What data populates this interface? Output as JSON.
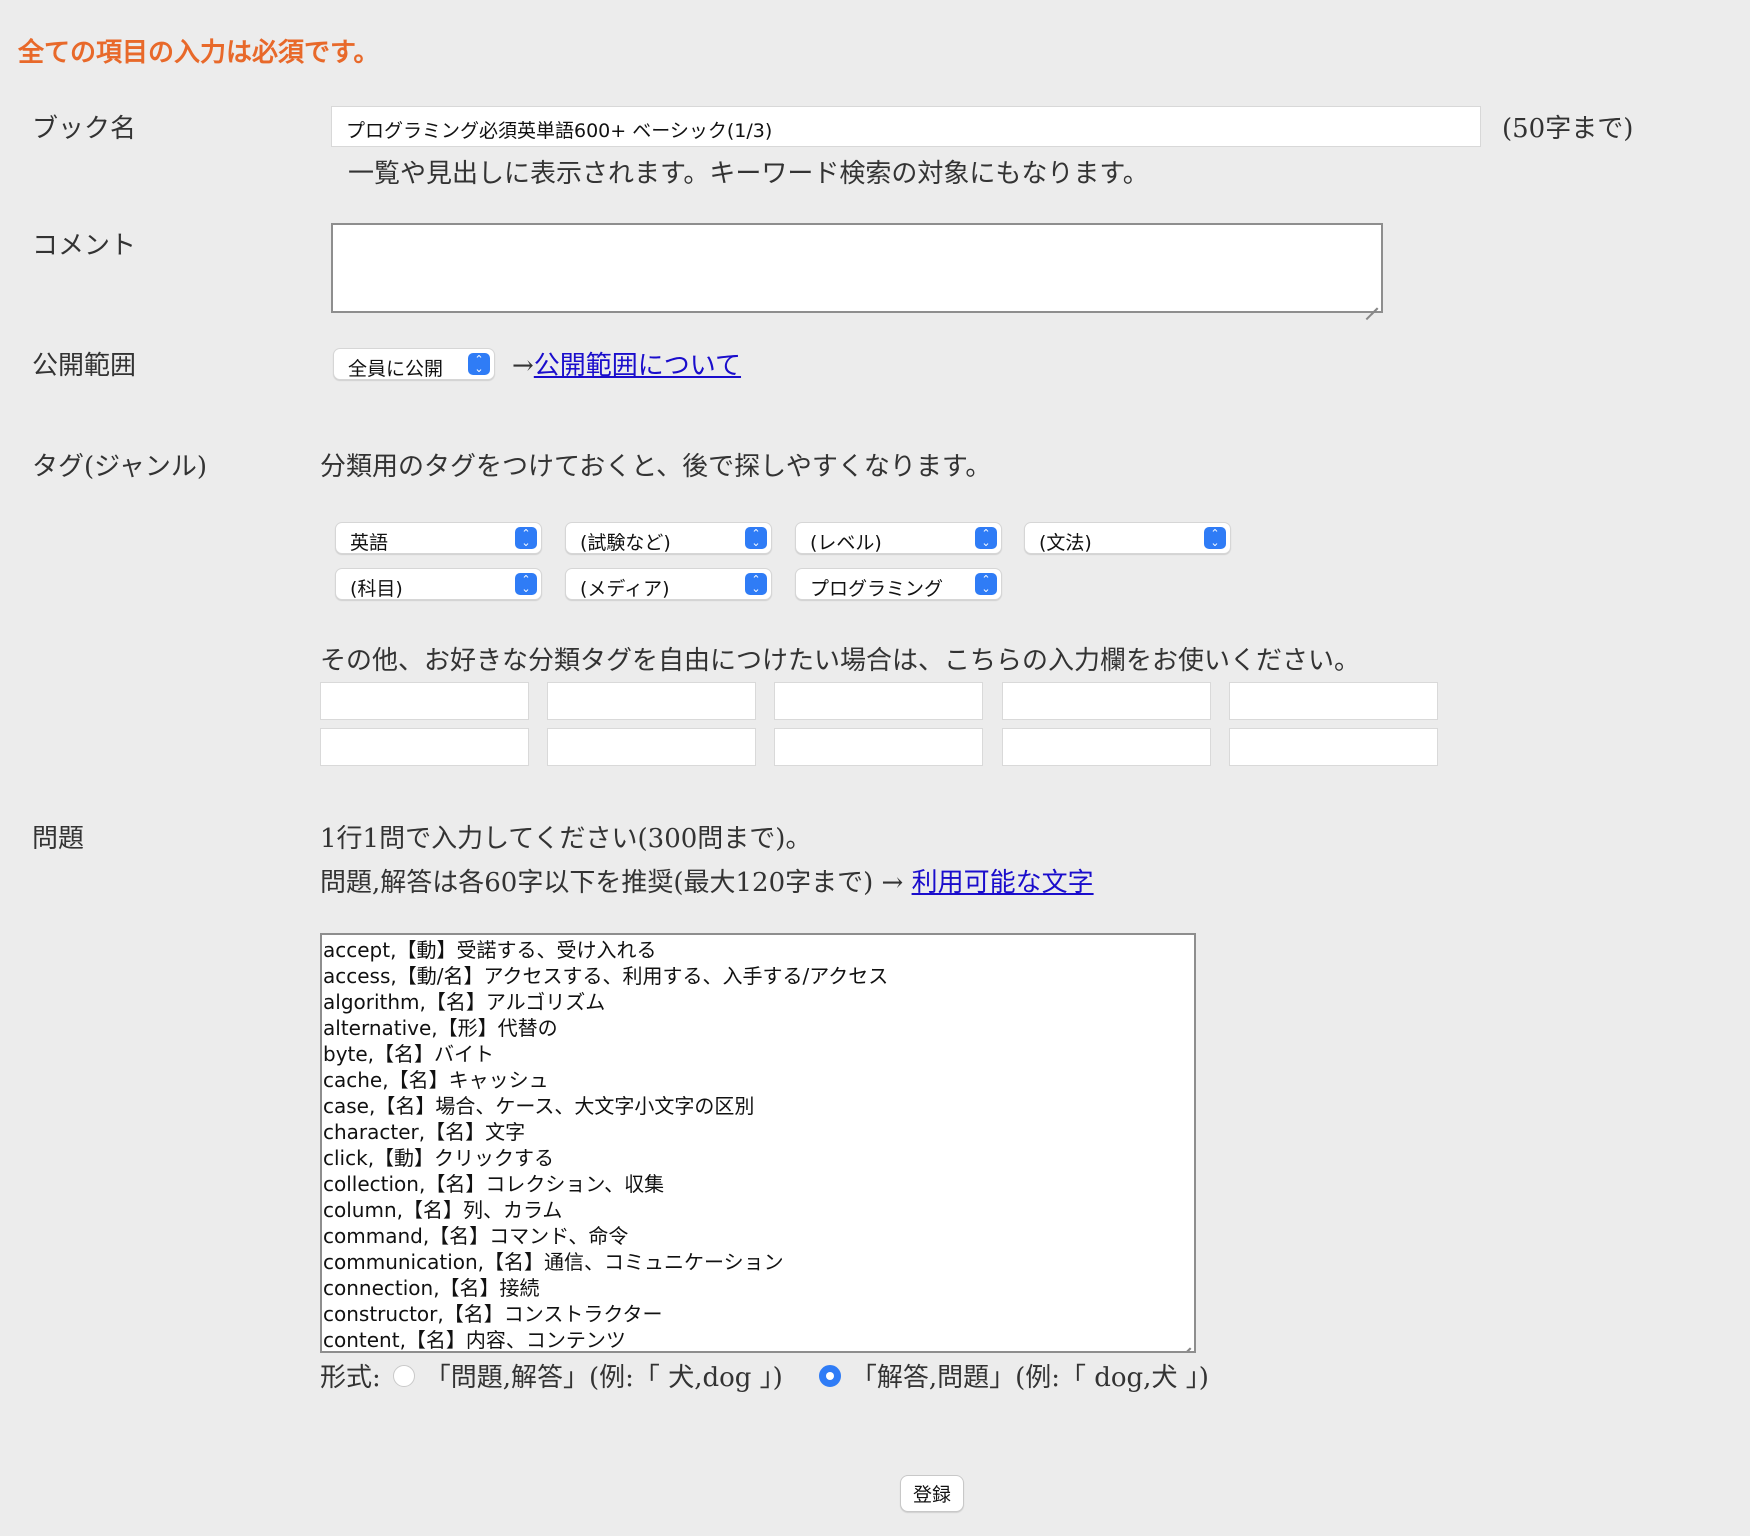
{
  "notice": "全ての項目の入力は必須です。",
  "book_name": {
    "label": "ブック名",
    "value": "プログラミング必須英単語600+ ベーシック(1/3)",
    "limit": "(50字まで)",
    "hint": "一覧や見出しに表示されます。キーワード検索の対象にもなります。"
  },
  "comment": {
    "label": "コメント",
    "value": ""
  },
  "visibility": {
    "label": "公開範囲",
    "selected": "全員に公開",
    "arrow": "→",
    "link": "公開範囲について"
  },
  "tags": {
    "label": "タグ(ジャンル)",
    "hint": "分類用のタグをつけておくと、後で探しやすくなります。",
    "selects": [
      "英語",
      "(試験など)",
      "(レベル)",
      "(文法)",
      "(科目)",
      "(メディア)",
      "プログラミング"
    ],
    "free_hint": "その他、お好きな分類タグを自由につけたい場合は、こちらの入力欄をお使いください。",
    "free_values": [
      "",
      "",
      "",
      "",
      "",
      "",
      "",
      "",
      "",
      ""
    ]
  },
  "questions": {
    "label": "問題",
    "hint1": "1行1問で入力してください(300問まで)。",
    "hint2": "問題,解答は各60字以下を推奨(最大120字まで) →",
    "link": "利用可能な文字",
    "lines": [
      "accept,【動】受諾する、受け入れる",
      "access,【動/名】アクセスする、利用する、入手する/アクセス",
      "algorithm,【名】アルゴリズム",
      "alternative,【形】代替の",
      "byte,【名】バイト",
      "cache,【名】キャッシュ",
      "case,【名】場合、ケース、大文字小文字の区別",
      "character,【名】文字",
      "click,【動】クリックする",
      "collection,【名】コレクション、収集",
      "column,【名】列、カラム",
      "command,【名】コマンド、命令",
      "communication,【名】通信、コミュニケーション",
      "connection,【名】接続",
      "constructor,【名】コンストラクター",
      "content,【名】内容、コンテンツ"
    ]
  },
  "format": {
    "label": "形式:",
    "option1": "「問題,解答」(例:「 犬,dog 」)",
    "option2": "「解答,問題」(例:「 dog,犬 」)",
    "selected": "option2"
  },
  "submit": "登録"
}
